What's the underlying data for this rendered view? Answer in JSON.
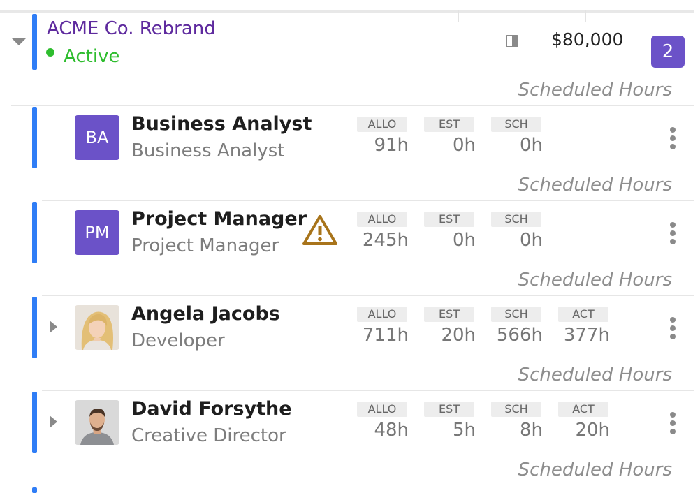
{
  "project": {
    "name": "ACME Co. Rebrand",
    "status": "Active",
    "budget": "$80,000",
    "member_count": "2"
  },
  "scheduled_hours_label": "Scheduled Hours",
  "stat_labels": {
    "allo": "ALLO",
    "est": "EST",
    "sch": "SCH",
    "act": "ACT"
  },
  "members": [
    {
      "initials": "BA",
      "name": "Business Analyst",
      "role": "Business Analyst",
      "allo": "91h",
      "est": "0h",
      "sch": "0h"
    },
    {
      "initials": "PM",
      "name": "Project Manager",
      "role": "Project Manager",
      "allo": "245h",
      "est": "0h",
      "sch": "0h"
    },
    {
      "name": "Angela Jacobs",
      "role": "Developer",
      "allo": "711h",
      "est": "20h",
      "sch": "566h",
      "act": "377h"
    },
    {
      "name": "David Forsythe",
      "role": "Creative Director",
      "allo": "48h",
      "est": "5h",
      "sch": "8h",
      "act": "20h"
    }
  ],
  "colors": {
    "accent_bar": "#2f7df6",
    "project_title": "#5e2a9e",
    "active_status": "#2ebd2e",
    "badge": "#6b52c8",
    "warning": "#a8741b"
  },
  "icons": {
    "collapse": "caret-down-icon",
    "expand": "caret-right-icon",
    "panel": "panel-toggle-icon",
    "warning": "warning-icon",
    "menu": "kebab-menu-icon"
  }
}
